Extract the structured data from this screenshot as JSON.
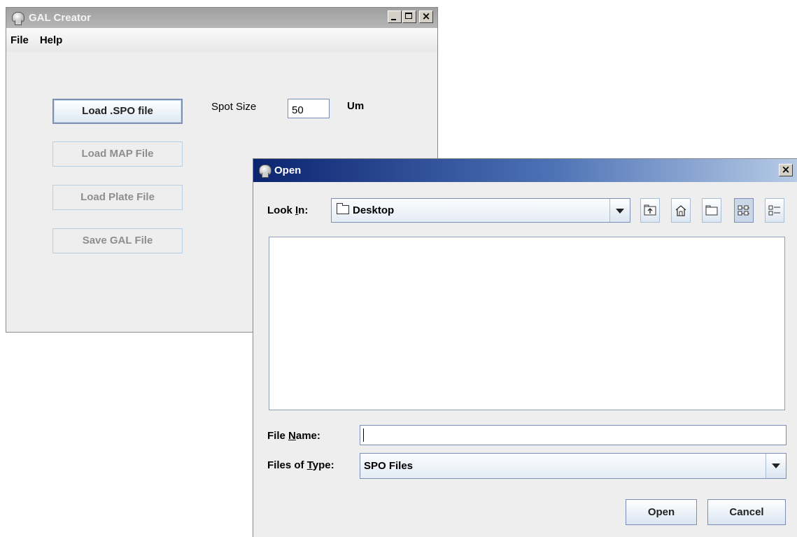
{
  "main_window": {
    "title": "GAL Creator",
    "menu": [
      "File",
      "Help"
    ],
    "buttons": {
      "load_spo": "Load .SPO file",
      "load_map": "Load MAP File",
      "load_plate": "Load Plate File",
      "save_gal": "Save GAL File"
    },
    "spot_size": {
      "label": "Spot Size",
      "value": "50",
      "unit": "Um"
    }
  },
  "open_dialog": {
    "title": "Open",
    "look_in": {
      "label_pre": "Look ",
      "label_mn": "I",
      "label_post": "n:",
      "value": "Desktop"
    },
    "toolbar_icons": [
      "up-one-level-icon",
      "home-icon",
      "new-folder-icon",
      "list-view-icon",
      "details-view-icon"
    ],
    "file_name": {
      "label_pre": "File ",
      "label_mn": "N",
      "label_post": "ame:",
      "value": ""
    },
    "files_of_type": {
      "label_pre": "Files of ",
      "label_mn": "T",
      "label_post": "ype:",
      "value": "SPO Files"
    },
    "buttons": {
      "open": "Open",
      "cancel": "Cancel"
    }
  }
}
